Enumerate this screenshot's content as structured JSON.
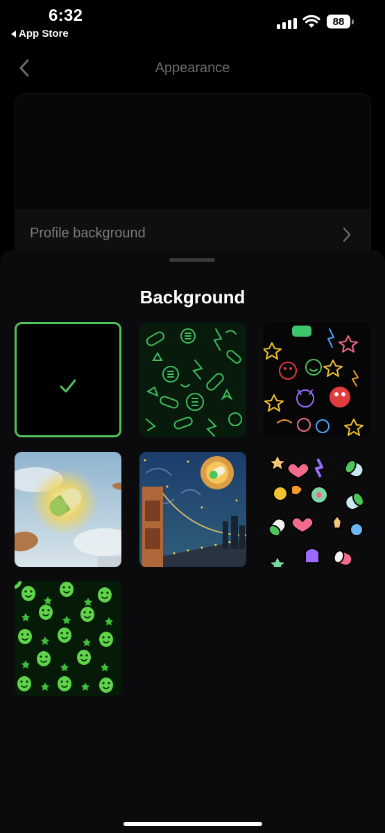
{
  "status_bar": {
    "time": "6:32",
    "back_app": "App Store",
    "battery": "88"
  },
  "nav": {
    "title": "Appearance",
    "back_icon": "chevron-left-icon"
  },
  "settings": {
    "profile_background_label": "Profile background"
  },
  "sheet": {
    "title": "Background",
    "selected_index": 0,
    "options": [
      {
        "id": "none",
        "description": "plain black (selected)"
      },
      {
        "id": "green-doodle",
        "description": "green line doodle pattern"
      },
      {
        "id": "neon-doodle",
        "description": "colorful neon doodles"
      },
      {
        "id": "sky-pill",
        "description": "glowing pill in sky"
      },
      {
        "id": "bridge-night",
        "description": "bridge under starry night"
      },
      {
        "id": "sticker-pattern",
        "description": "pastel sticker pattern"
      },
      {
        "id": "smiley-pattern",
        "description": "green smiley faces"
      }
    ]
  },
  "colors": {
    "accent": "#4ec45a",
    "background": "#000000",
    "sheet": "#0b0b0d"
  }
}
